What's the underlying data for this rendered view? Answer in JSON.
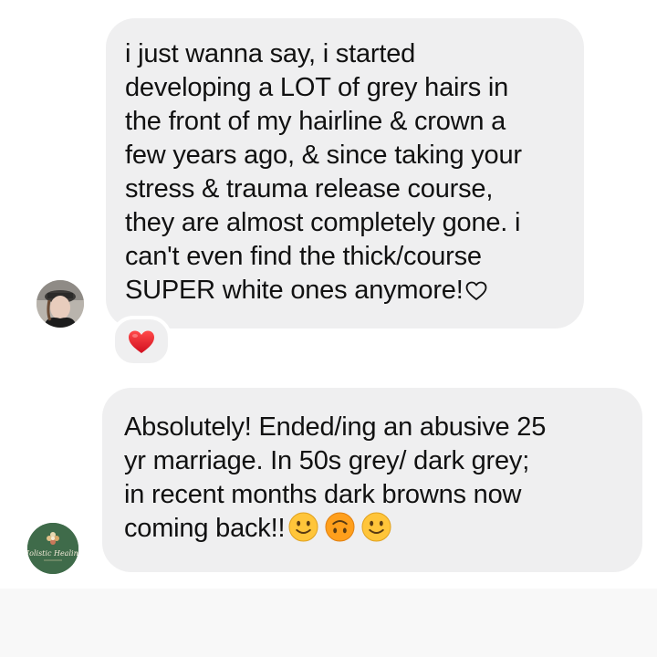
{
  "messages": [
    {
      "text": "i just wanna say, i started\ndeveloping a LOT of grey hairs in\nthe front of my hairline & crown a\nfew years ago, & since taking your\nstress & trauma release course,\nthey are almost completely gone. i\ncan't even find the thick/course\nSUPER white ones anymore!",
      "trailing_icon": "outline-heart-icon",
      "reaction": "red-heart-emoji",
      "avatar": "user-avatar-photo"
    },
    {
      "text": "Absolutely! Ended/ing an abusive 25\nyr marriage. In 50s grey/ dark grey;\nin recent months dark browns now\ncoming back!!",
      "trailing_emojis": [
        "slightly-smiling-face",
        "upside-down-face",
        "slightly-smiling-face"
      ],
      "avatar": "holistic-healing-logo",
      "avatar_logo_text": "Holistic Healing"
    }
  ],
  "colors": {
    "bubble": "#efeff0",
    "text": "#111111",
    "reaction_heart": "#e1212b",
    "emoji_face": "#ffc53a",
    "avatar_logo_bg": "#3f6b4a"
  }
}
